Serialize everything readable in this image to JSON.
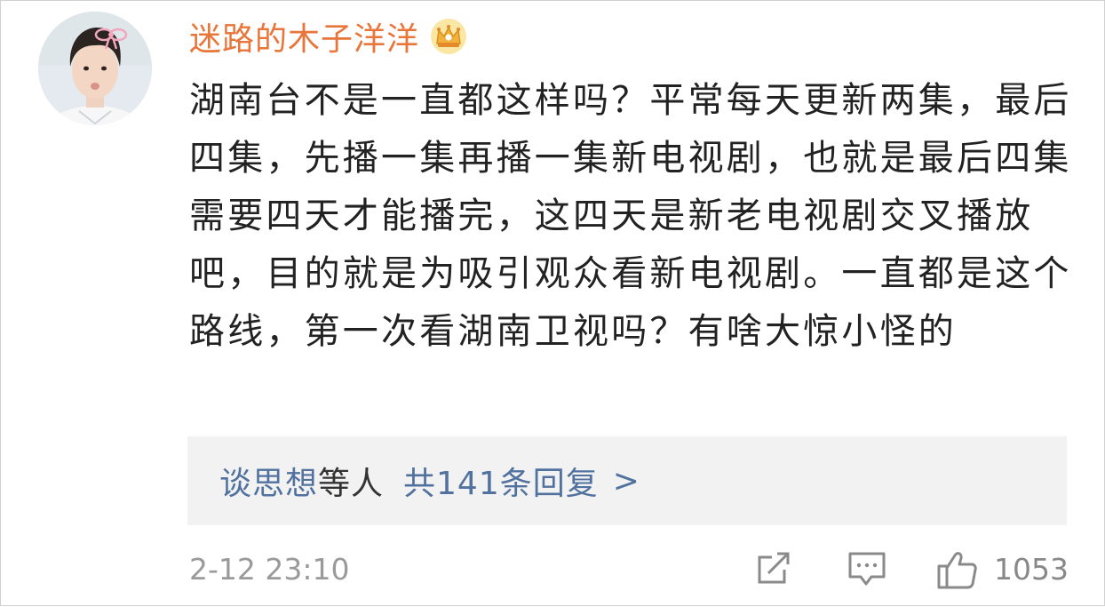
{
  "comment": {
    "username": "迷路的木子洋洋",
    "vip_badge_icon": "crown-badge-icon",
    "avatar_icon": "user-avatar",
    "text": "湖南台不是一直都这样吗？平常每天更新两集，最后四集，先播一集再播一集新电视剧，也就是最后四集需要四天才能播完，这四天是新老电视剧交叉播放吧，目的就是为吸引观众看新电视剧。一直都是这个路线，第一次看湖南卫视吗？有啥大惊小怪的",
    "replies": {
      "user": "谈思想",
      "suffix": "等人",
      "count_text": "共141条回复",
      "arrow": ">"
    },
    "timestamp": "2-12 23:10",
    "actions": {
      "share_icon": "share-icon",
      "reply_icon": "comment-icon",
      "like_icon": "thumbs-up-icon",
      "like_count": "1053"
    }
  },
  "colors": {
    "username": "#e8753a",
    "link": "#51729e",
    "text": "#222222",
    "muted": "#9a9a9a",
    "reply_bg": "#f2f2f2",
    "icon": "#888888"
  }
}
